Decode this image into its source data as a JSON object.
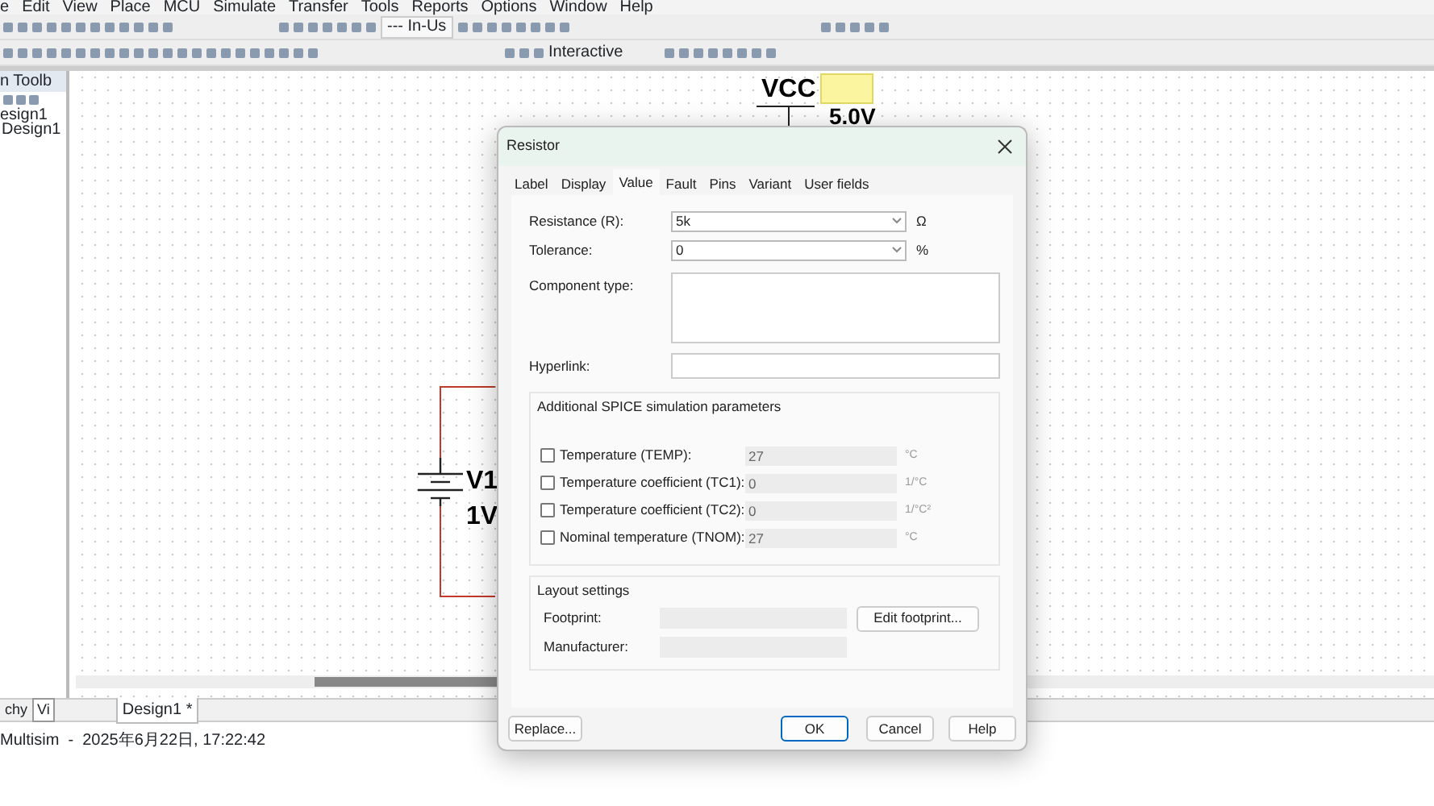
{
  "menu": [
    "e",
    "Edit",
    "View",
    "Place",
    "MCU",
    "Simulate",
    "Transfer",
    "Tools",
    "Reports",
    "Options",
    "Window",
    "Help"
  ],
  "toolbar": {
    "combo": "--- In-Us",
    "mode": "Interactive"
  },
  "design_toolbox": {
    "title": "n Toolb",
    "tree": [
      {
        "label": "esign1",
        "children": [
          {
            "label": "Design1"
          }
        ]
      }
    ],
    "tabs": [
      {
        "label": "chy",
        "selected": false
      },
      {
        "label": "Vi",
        "selected": true
      }
    ]
  },
  "schematic": {
    "labels": [
      "VCC",
      "5.0V",
      "V1",
      "1V"
    ]
  },
  "document_tabs": [
    {
      "label": "Design1 *",
      "selected": true
    }
  ],
  "status_bar": "Multisim  -  2025年6月22日, 17:22:42",
  "dialog": {
    "title": "Resistor",
    "tabs": [
      {
        "label": "Label",
        "selected": false
      },
      {
        "label": "Display",
        "selected": false
      },
      {
        "label": "Value",
        "selected": true
      },
      {
        "label": "Fault",
        "selected": false
      },
      {
        "label": "Pins",
        "selected": false
      },
      {
        "label": "Variant",
        "selected": false
      },
      {
        "label": "User fields",
        "selected": false
      }
    ],
    "fields": [
      {
        "label": "Resistance (R):",
        "value": "5k",
        "unit": "Ω"
      },
      {
        "label": "Tolerance:",
        "value": "0",
        "unit": "%"
      }
    ],
    "component_type": {
      "label": "Component type:"
    },
    "hyperlink": {
      "label": "Hyperlink:"
    },
    "spice": {
      "title": "Additional SPICE simulation parameters",
      "params": [
        {
          "label": "Temperature (TEMP):",
          "value": "27",
          "unit": "°C",
          "checked": false
        },
        {
          "label": "Temperature coefficient (TC1):",
          "value": "0",
          "unit": "1/°C",
          "checked": false
        },
        {
          "label": "Temperature coefficient (TC2):",
          "value": "0",
          "unit": "1/°C²",
          "checked": false
        },
        {
          "label": "Nominal temperature (TNOM):",
          "value": "27",
          "unit": "°C",
          "checked": false
        }
      ]
    },
    "layout": {
      "title": "Layout settings",
      "footprint_label": "Footprint:",
      "manufacturer_label": "Manufacturer:",
      "edit_button": "Edit footprint..."
    },
    "buttons": [
      {
        "label": "Replace...",
        "focused": false
      },
      {
        "label": "OK",
        "focused": true
      },
      {
        "label": "Cancel",
        "focused": false
      },
      {
        "label": "Help",
        "focused": false
      }
    ]
  }
}
